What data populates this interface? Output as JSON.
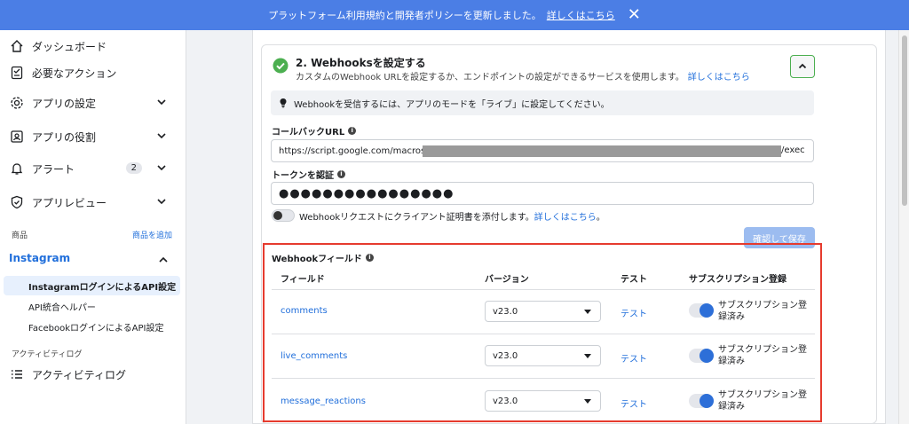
{
  "banner": {
    "message": "プラットフォーム利用規約と開発者ポリシーを更新しました。",
    "link": "詳しくはこちら"
  },
  "sidebar": {
    "items": [
      {
        "label": "ダッシュボード",
        "icon": "home-icon"
      },
      {
        "label": "必要なアクション",
        "icon": "checklist-icon"
      },
      {
        "label": "アプリの設定",
        "icon": "gear-icon"
      },
      {
        "label": "アプリの役割",
        "icon": "id-card-icon"
      },
      {
        "label": "アラート",
        "icon": "bell-icon",
        "badge": "2"
      },
      {
        "label": "アプリレビュー",
        "icon": "shield-check-icon"
      }
    ],
    "products_label": "商品",
    "add_product": "商品を追加",
    "instagram": {
      "label": "Instagram",
      "subitems": [
        "InstagramログインによるAPI設定",
        "API統合ヘルパー",
        "FacebookログインによるAPI設定"
      ]
    },
    "activity_label": "アクティビティログ",
    "activity_item": "アクティビティログ"
  },
  "step": {
    "title": "2. Webhooksを設定する",
    "description": "カスタムのWebhook URLを設定するか、エンドポイントの設定ができるサービスを使用します。",
    "learn_more": "詳しくはこちら"
  },
  "info_notice": "Webhookを受信するには、アプリのモードを「ライブ」に設定してください。",
  "callback": {
    "label": "コールバックURL",
    "value_prefix": "https://script.google.com/macros/s/",
    "value_suffix": "/exec"
  },
  "token": {
    "label": "トークンを認証",
    "value": "●●●●●●●●●●●●●●●●"
  },
  "client_cert": {
    "text": "Webhookリクエストにクライアント証明書を添付します。",
    "link": "詳しくはこちら",
    "end": "。"
  },
  "save_button": "確認して保存",
  "webhook_fields": {
    "title": "Webhookフィールド",
    "columns": [
      "フィールド",
      "バージョン",
      "テスト",
      "サブスクリプション登録"
    ],
    "rows": [
      {
        "field": "comments",
        "version": "v23.0",
        "test": "テスト",
        "status": "サブスクリプション登録済み"
      },
      {
        "field": "live_comments",
        "version": "v23.0",
        "test": "テスト",
        "status": "サブスクリプション登録済み"
      },
      {
        "field": "message_reactions",
        "version": "v23.0",
        "test": "テスト",
        "status": "サブスクリプション登録済み"
      }
    ]
  },
  "colors": {
    "banner": "#4b7ee5",
    "link": "#216fdb",
    "highlight_border": "#e63b2e",
    "toggle_on": "#2d6fd8",
    "success": "#4caf50"
  }
}
